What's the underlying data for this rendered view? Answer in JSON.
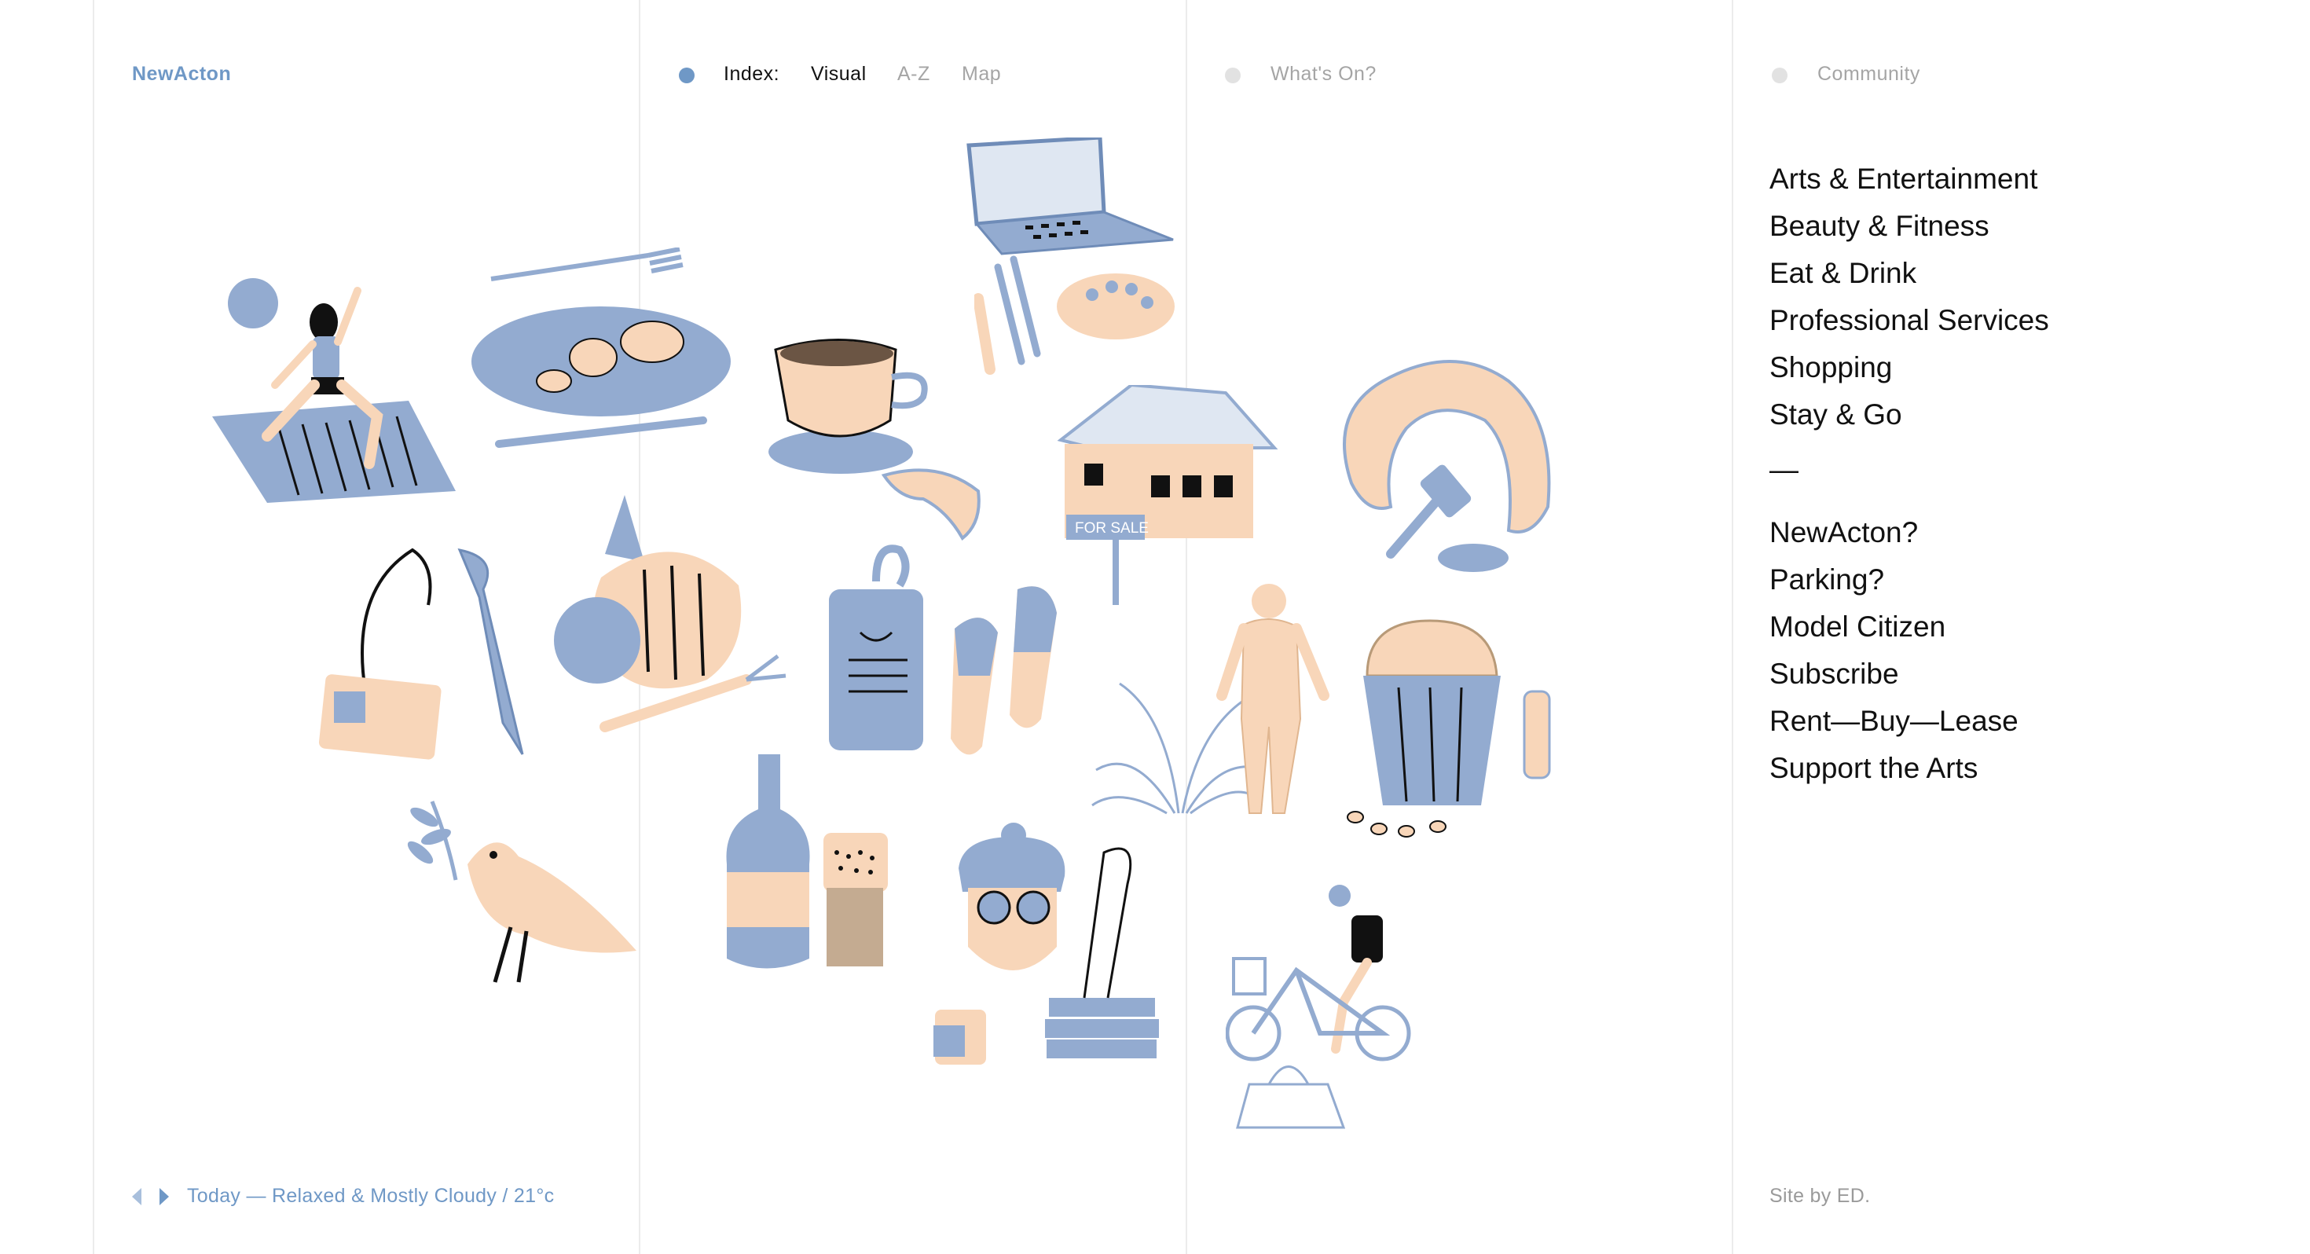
{
  "header": {
    "logo": "NewActon",
    "index_label": "Index:",
    "tabs": [
      "Visual",
      "A-Z",
      "Map"
    ],
    "whats_on": "What's On?",
    "community": "Community"
  },
  "sidebar": {
    "categories": [
      "Arts & Entertainment",
      "Beauty & Fitness",
      "Eat & Drink",
      "Professional Services",
      "Shopping",
      "Stay & Go"
    ],
    "separator": "—",
    "links": [
      "NewActon?",
      "Parking?",
      "Model Citizen",
      "Subscribe",
      "Rent—Buy—Lease",
      "Support the Arts"
    ]
  },
  "footer": {
    "weather": "Today — Relaxed & Mostly Cloudy / 21°c",
    "credit": "Site by ED."
  },
  "illustrations": {
    "for_sale_sign": "FOR SALE"
  },
  "colors": {
    "accent_blue": "#6f98c6",
    "illus_blue": "#93abd0",
    "illus_peach": "#f8d6b9",
    "divider": "#ececec",
    "inactive_dot": "#e2e2e2"
  }
}
